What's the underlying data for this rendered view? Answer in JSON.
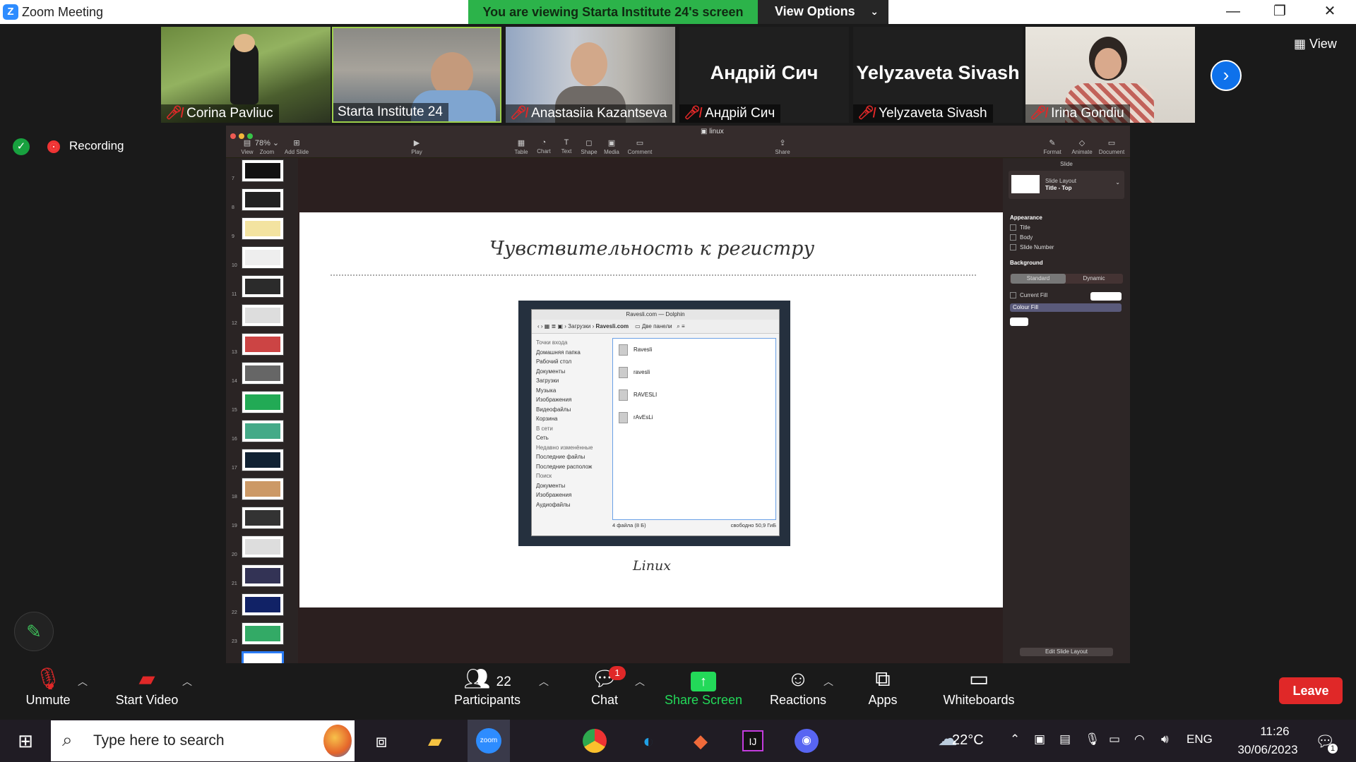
{
  "window": {
    "title": "Zoom Meeting",
    "share_banner": "You are viewing Starta Institute 24's screen",
    "view_options": "View Options",
    "min": "—",
    "max": "❐",
    "close": "✕"
  },
  "participants": [
    {
      "name": "Corina Pavliuc",
      "muted": true,
      "video": true
    },
    {
      "name": "Starta Institute 24",
      "muted": false,
      "video": true,
      "active": true
    },
    {
      "name": "Anastasiia Kazantseva",
      "muted": true,
      "video": true
    },
    {
      "name": "Андрій Сич",
      "muted": true,
      "video": false
    },
    {
      "name": "Yelyzaveta Sivash",
      "muted": true,
      "video": false
    },
    {
      "name": "Irina Gondiu",
      "muted": true,
      "video": true
    }
  ],
  "view_label": "View",
  "recording_label": "Recording",
  "keynote": {
    "doc_title": "linux",
    "toolbar": [
      {
        "label": "View",
        "icon": "▤"
      },
      {
        "label": "Zoom",
        "icon": "78% ⌄"
      },
      {
        "label": "Add Slide",
        "icon": "⊞"
      },
      {
        "label": "Play",
        "icon": "▶"
      },
      {
        "label": "Table",
        "icon": "▦"
      },
      {
        "label": "Chart",
        "icon": "◔"
      },
      {
        "label": "Text",
        "icon": "T"
      },
      {
        "label": "Shape",
        "icon": "◻"
      },
      {
        "label": "Media",
        "icon": "▣"
      },
      {
        "label": "Comment",
        "icon": "▭"
      },
      {
        "label": "Share",
        "icon": "⇪"
      },
      {
        "label": "Format",
        "icon": "✎"
      },
      {
        "label": "Animate",
        "icon": "◇"
      },
      {
        "label": "Document",
        "icon": "▭"
      }
    ],
    "slide_numbers": [
      "7",
      "8",
      "9",
      "10",
      "11",
      "12",
      "13",
      "14",
      "15",
      "16",
      "17",
      "18",
      "19",
      "20",
      "21",
      "22",
      "23",
      "24"
    ],
    "slide": {
      "title": "Чувствительность к регистру",
      "caption": "Linux"
    },
    "dolphin": {
      "title": "Ravesli.com — Dolphin",
      "path_prev": "Загрузки",
      "path_current": "Ravesli.com",
      "split": "Две панели",
      "sidebar": [
        {
          "text": "Точки входа",
          "hd": true
        },
        {
          "text": "Домашняя папка"
        },
        {
          "text": "Рабочий стол"
        },
        {
          "text": "Документы"
        },
        {
          "text": "Загрузки"
        },
        {
          "text": "Музыка"
        },
        {
          "text": "Изображения"
        },
        {
          "text": "Видеофайлы"
        },
        {
          "text": "Корзина"
        },
        {
          "text": "В сети",
          "hd": true
        },
        {
          "text": "Сеть"
        },
        {
          "text": "Недавно изменённые",
          "hd": true
        },
        {
          "text": "Последние файлы"
        },
        {
          "text": "Последние располож"
        },
        {
          "text": "Поиск",
          "hd": true
        },
        {
          "text": "Документы"
        },
        {
          "text": "Изображения"
        },
        {
          "text": "Аудиофайлы"
        }
      ],
      "files": [
        "Ravesli",
        "ravesli",
        "RAVESLI",
        "rAvEsLi"
      ],
      "status_left": "4 файла (8 Б)",
      "status_right": "свободно 50,9 ГиБ"
    },
    "inspector": {
      "header": "Slide",
      "layout_label": "Slide Layout",
      "layout_value": "Title - Top",
      "appearance": "Appearance",
      "cb_title": "Title",
      "cb_body": "Body",
      "cb_number": "Slide Number",
      "background": "Background",
      "seg_standard": "Standard",
      "seg_dynamic": "Dynamic",
      "current_fill": "Current Fill",
      "fill_type": "Colour Fill",
      "edit_layout": "Edit Slide Layout"
    }
  },
  "controls": {
    "unmute": "Unmute",
    "start_video": "Start Video",
    "participants": "Participants",
    "participants_count": "22",
    "chat": "Chat",
    "chat_badge": "1",
    "share_screen": "Share Screen",
    "reactions": "Reactions",
    "apps": "Apps",
    "whiteboards": "Whiteboards",
    "leave": "Leave"
  },
  "taskbar": {
    "search_placeholder": "Type here to search",
    "zoom_label": "zoom",
    "weather": "22°C",
    "lang": "ENG",
    "time": "11:26",
    "date": "30/06/2023",
    "notif_count": "1"
  },
  "colors": {
    "banner_green": "#2cb34a",
    "zoom_blue": "#0e71eb",
    "leave_red": "#e02828",
    "share_green": "#23d959"
  }
}
